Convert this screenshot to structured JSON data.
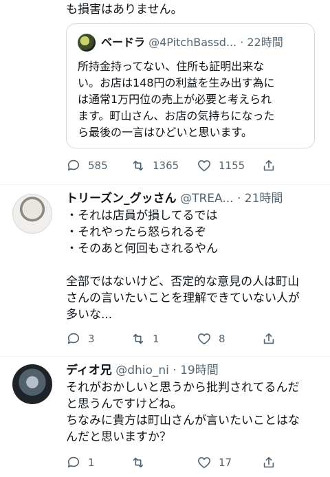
{
  "previous_tail": "も損害はありません。",
  "quote": {
    "name": "ベードラ",
    "handle": "@4PitchBassd...",
    "time": "· 22時間",
    "lines": [
      "所持金持ってない、住所も証明出来な",
      "い。お店は148円の利益を生み出す為に",
      "は通常1万円位の売上が必要と考えられ",
      "ます。町山さん、お店の気持ちになった",
      "ら最後の一言はひどいと思います。"
    ]
  },
  "actions_1": {
    "replies": "585",
    "retweets": "1365",
    "likes": "1155"
  },
  "tweet_1": {
    "name": "トリーズン_グッさん",
    "handle": "@TREA...",
    "time": "· 21時間",
    "lines": [
      "・それは店員が損してるでは",
      "・それやったら怒られるぞ",
      "・そのあと何回もされるやん",
      "",
      "全部ではないけど、否定的な意見の人は町山",
      "さんの言いたいことを理解できていない人が",
      "多いな..."
    ],
    "replies": "3",
    "retweets": "1",
    "likes": "8"
  },
  "tweet_2": {
    "name": "ディオ兄",
    "handle": "@dhio_ni",
    "time": "· 19時間",
    "lines": [
      "それがおかしいと思うから批判されてるんだ",
      "と思うんですけどね。",
      "ちなみに貴方は町山さんが言いたいことはな",
      "んだと思いますか？"
    ],
    "replies": "1",
    "retweets": "",
    "likes": "17"
  }
}
